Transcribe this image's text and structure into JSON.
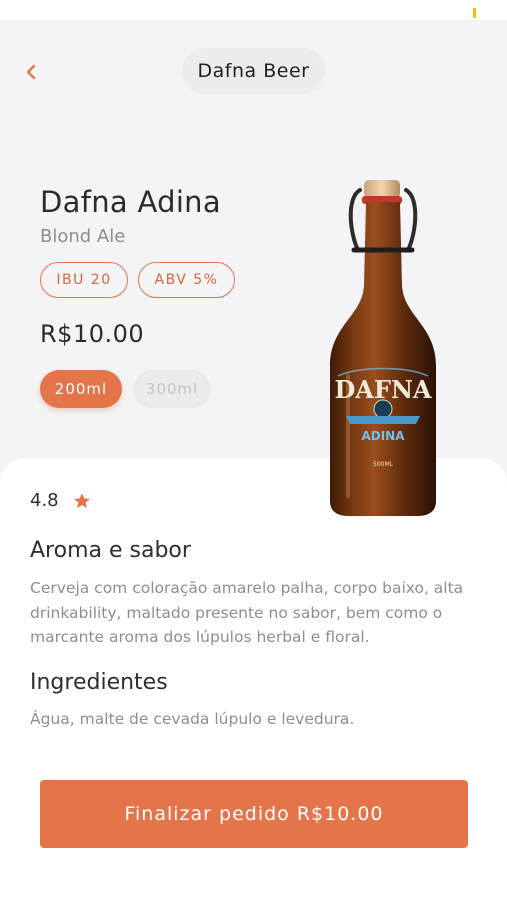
{
  "header": {
    "title": "Dafna Beer"
  },
  "product": {
    "name": "Dafna Adina",
    "style": "Blond Ale",
    "ibu": "IBU 20",
    "abv": "ABV 5%",
    "price": "R$10.00",
    "sizes": [
      "200ml",
      "300ml"
    ],
    "selected_size": "200ml"
  },
  "bottle_label": {
    "brand": "DAFNA",
    "variant": "ADINA",
    "volume": "500ML"
  },
  "rating": {
    "value": "4.8",
    "icon": "star-icon"
  },
  "aroma": {
    "title": "Aroma e sabor",
    "text": "Cerveja com coloração amarelo palha, corpo baixo, alta drinkability, maltado presente no sabor, bem como o marcante aroma dos lúpulos herbal e floral."
  },
  "ingredients": {
    "title": "Ingredientes",
    "text": "Água, malte de cevada lúpulo e levedura."
  },
  "checkout": {
    "label": "Finalizar pedido R$10.00"
  },
  "colors": {
    "accent": "#e4744a",
    "background": "#f3f3f5",
    "sheet": "#ffffff",
    "muted_text": "#8d8d92"
  }
}
